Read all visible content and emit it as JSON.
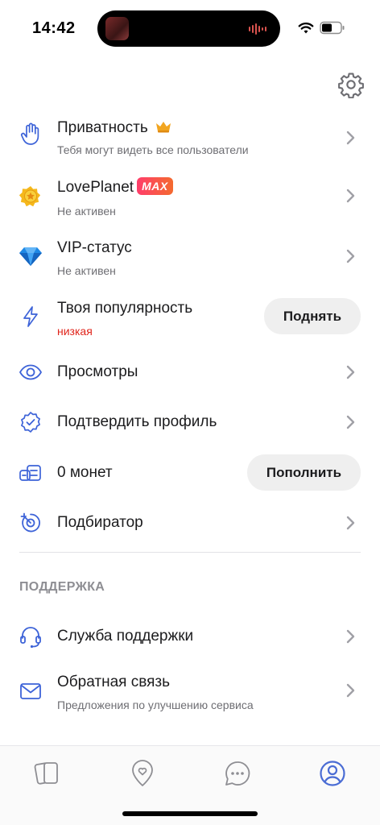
{
  "status_bar": {
    "time": "14:42"
  },
  "menu": {
    "privacy": {
      "title": "Приватность",
      "subtitle": "Тебя могут видеть все пользователи",
      "icon": "hand-icon"
    },
    "loveplanet": {
      "title": "LovePlanet",
      "badge": "MAX",
      "subtitle": "Не активен",
      "icon": "star-medal-icon"
    },
    "vip": {
      "title": "VIP-статус",
      "subtitle": "Не активен",
      "icon": "diamond-icon"
    },
    "popularity": {
      "title": "Твоя популярность",
      "subtitle": "низкая",
      "button": "Поднять",
      "icon": "lightning-icon"
    },
    "views": {
      "title": "Просмотры",
      "icon": "eye-icon"
    },
    "verify": {
      "title": "Подтвердить профиль",
      "icon": "verified-badge-icon"
    },
    "coins": {
      "title": "0 монет",
      "button": "Пополнить",
      "icon": "coins-icon"
    },
    "matcher": {
      "title": "Подбиратор",
      "icon": "target-icon"
    }
  },
  "support": {
    "header": "ПОДДЕРЖКА",
    "service": {
      "title": "Служба поддержки",
      "icon": "headset-icon"
    },
    "feedback": {
      "title": "Обратная связь",
      "subtitle": "Предложения по улучшению сервиса",
      "icon": "mail-icon"
    }
  },
  "tabs": [
    {
      "name": "cards",
      "icon": "cards-icon",
      "active": false
    },
    {
      "name": "nearby",
      "icon": "location-heart-icon",
      "active": false
    },
    {
      "name": "messages",
      "icon": "chat-icon",
      "active": false
    },
    {
      "name": "profile",
      "icon": "profile-icon",
      "active": true
    }
  ],
  "colors": {
    "accent": "#4a6cd4",
    "icon_blue": "#3d63d8",
    "danger": "#e0241b",
    "inactive_tab": "#8e8e93"
  }
}
